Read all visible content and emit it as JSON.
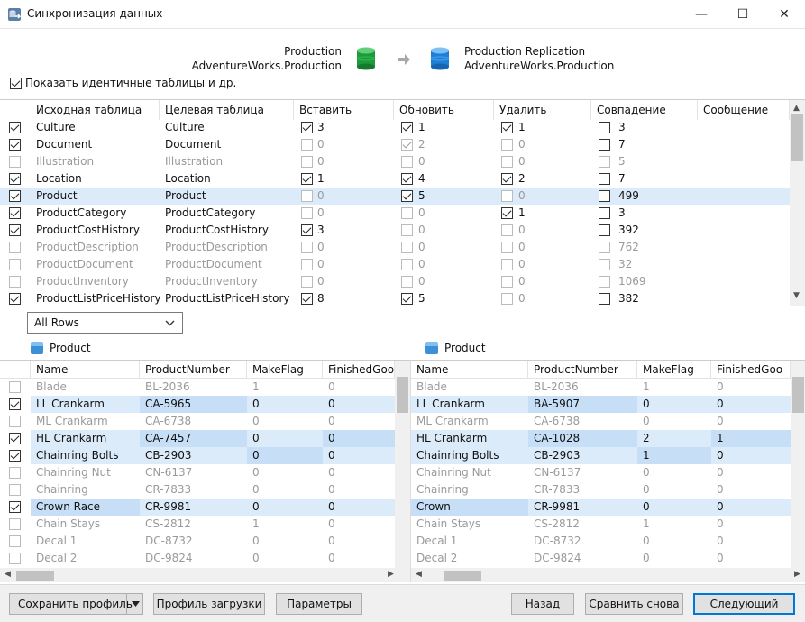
{
  "window": {
    "title": "Синхронизация данных",
    "min": "—",
    "max": "☐",
    "close": "✕"
  },
  "source": {
    "server": "Production",
    "database": "AdventureWorks.Production",
    "color": "#1e9a3c"
  },
  "target": {
    "server": "Production Replication",
    "database": "AdventureWorks.Production",
    "color": "#1e7fd6"
  },
  "show_identical_label": "Показать идентичные таблицы и др.",
  "tables_grid": {
    "headers": [
      "Исходная таблица",
      "Целевая таблица",
      "Вставить",
      "Обновить",
      "Удалить",
      "Совпадение",
      "Сообщение"
    ],
    "rows": [
      {
        "checked": true,
        "enabled": true,
        "src": "Culture",
        "dst": "Culture",
        "ins": "3",
        "ins_on": true,
        "ins_en": true,
        "upd": "1",
        "upd_on": true,
        "upd_en": true,
        "del": "1",
        "del_on": true,
        "del_en": true,
        "match": "3",
        "match_en": true,
        "sel": false
      },
      {
        "checked": true,
        "enabled": true,
        "src": "Document",
        "dst": "Document",
        "ins": "0",
        "ins_on": false,
        "ins_en": false,
        "upd": "2",
        "upd_on": true,
        "upd_en": false,
        "del": "0",
        "del_on": false,
        "del_en": false,
        "match": "7",
        "match_en": true,
        "sel": false
      },
      {
        "checked": false,
        "enabled": false,
        "src": "Illustration",
        "dst": "Illustration",
        "ins": "0",
        "ins_on": false,
        "ins_en": false,
        "upd": "0",
        "upd_on": false,
        "upd_en": false,
        "del": "0",
        "del_on": false,
        "del_en": false,
        "match": "5",
        "match_en": false,
        "sel": false
      },
      {
        "checked": true,
        "enabled": true,
        "src": "Location",
        "dst": "Location",
        "ins": "1",
        "ins_on": true,
        "ins_en": true,
        "upd": "4",
        "upd_on": true,
        "upd_en": true,
        "del": "2",
        "del_on": true,
        "del_en": true,
        "match": "7",
        "match_en": true,
        "sel": false
      },
      {
        "checked": true,
        "enabled": true,
        "src": "Product",
        "dst": "Product",
        "ins": "0",
        "ins_on": false,
        "ins_en": false,
        "upd": "5",
        "upd_on": true,
        "upd_en": true,
        "del": "0",
        "del_on": false,
        "del_en": false,
        "match": "499",
        "match_en": true,
        "sel": true
      },
      {
        "checked": true,
        "enabled": true,
        "src": "ProductCategory",
        "dst": "ProductCategory",
        "ins": "0",
        "ins_on": false,
        "ins_en": false,
        "upd": "0",
        "upd_on": false,
        "upd_en": false,
        "del": "1",
        "del_on": true,
        "del_en": true,
        "match": "3",
        "match_en": true,
        "sel": false
      },
      {
        "checked": true,
        "enabled": true,
        "src": "ProductCostHistory",
        "dst": "ProductCostHistory",
        "ins": "3",
        "ins_on": true,
        "ins_en": true,
        "upd": "0",
        "upd_on": false,
        "upd_en": false,
        "del": "0",
        "del_on": false,
        "del_en": false,
        "match": "392",
        "match_en": true,
        "sel": false
      },
      {
        "checked": false,
        "enabled": false,
        "src": "ProductDescription",
        "dst": "ProductDescription",
        "ins": "0",
        "ins_on": false,
        "ins_en": false,
        "upd": "0",
        "upd_on": false,
        "upd_en": false,
        "del": "0",
        "del_on": false,
        "del_en": false,
        "match": "762",
        "match_en": false,
        "sel": false
      },
      {
        "checked": false,
        "enabled": false,
        "src": "ProductDocument",
        "dst": "ProductDocument",
        "ins": "0",
        "ins_on": false,
        "ins_en": false,
        "upd": "0",
        "upd_on": false,
        "upd_en": false,
        "del": "0",
        "del_on": false,
        "del_en": false,
        "match": "32",
        "match_en": false,
        "sel": false
      },
      {
        "checked": false,
        "enabled": false,
        "src": "ProductInventory",
        "dst": "ProductInventory",
        "ins": "0",
        "ins_on": false,
        "ins_en": false,
        "upd": "0",
        "upd_on": false,
        "upd_en": false,
        "del": "0",
        "del_on": false,
        "del_en": false,
        "match": "1069",
        "match_en": false,
        "sel": false
      },
      {
        "checked": true,
        "enabled": true,
        "src": "ProductListPriceHistory",
        "dst": "ProductListPriceHistory",
        "ins": "8",
        "ins_on": true,
        "ins_en": true,
        "upd": "5",
        "upd_on": true,
        "upd_en": true,
        "del": "0",
        "del_on": false,
        "del_en": false,
        "match": "382",
        "match_en": true,
        "sel": false
      }
    ]
  },
  "filter": {
    "value": "All Rows"
  },
  "left_panel": {
    "title": "Product",
    "headers": [
      "Name",
      "ProductNumber",
      "MakeFlag",
      "FinishedGoo"
    ],
    "rows": [
      {
        "check": false,
        "state": "same",
        "name": "Blade",
        "num": "BL-2036",
        "make": "1",
        "fin": "0",
        "diff": []
      },
      {
        "check": true,
        "state": "diff",
        "name": "LL Crankarm",
        "num": "CA-5965",
        "make": "0",
        "fin": "0",
        "diff": [
          1
        ]
      },
      {
        "check": false,
        "state": "same",
        "name": "ML Crankarm",
        "num": "CA-6738",
        "make": "0",
        "fin": "0",
        "diff": []
      },
      {
        "check": true,
        "state": "diff",
        "name": "HL Crankarm",
        "num": "CA-7457",
        "make": "0",
        "fin": "0",
        "diff": [
          1,
          3
        ]
      },
      {
        "check": true,
        "state": "diff",
        "name": "Chainring Bolts",
        "num": "CB-2903",
        "make": "0",
        "fin": "0",
        "diff": [
          2
        ]
      },
      {
        "check": false,
        "state": "same",
        "name": "Chainring Nut",
        "num": "CN-6137",
        "make": "0",
        "fin": "0",
        "diff": []
      },
      {
        "check": false,
        "state": "same",
        "name": "Chainring",
        "num": "CR-7833",
        "make": "0",
        "fin": "0",
        "diff": []
      },
      {
        "check": true,
        "state": "diff",
        "name": "Crown Race",
        "num": "CR-9981",
        "make": "0",
        "fin": "0",
        "diff": [
          0
        ]
      },
      {
        "check": false,
        "state": "same",
        "name": "Chain Stays",
        "num": "CS-2812",
        "make": "1",
        "fin": "0",
        "diff": []
      },
      {
        "check": false,
        "state": "same",
        "name": "Decal 1",
        "num": "DC-8732",
        "make": "0",
        "fin": "0",
        "diff": []
      },
      {
        "check": false,
        "state": "same",
        "name": "Decal 2",
        "num": "DC-9824",
        "make": "0",
        "fin": "0",
        "diff": []
      }
    ]
  },
  "right_panel": {
    "title": "Product",
    "headers": [
      "Name",
      "ProductNumber",
      "MakeFlag",
      "FinishedGoo"
    ],
    "rows": [
      {
        "state": "same",
        "name": "Blade",
        "num": "BL-2036",
        "make": "1",
        "fin": "0",
        "diff": []
      },
      {
        "state": "diff",
        "name": "LL Crankarm",
        "num": "BA-5907",
        "make": "0",
        "fin": "0",
        "diff": [
          1
        ]
      },
      {
        "state": "same",
        "name": "ML Crankarm",
        "num": "CA-6738",
        "make": "0",
        "fin": "0",
        "diff": []
      },
      {
        "state": "diff",
        "name": "HL Crankarm",
        "num": "CA-1028",
        "make": "2",
        "fin": "1",
        "diff": [
          1,
          3
        ]
      },
      {
        "state": "diff",
        "name": "Chainring Bolts",
        "num": "CB-2903",
        "make": "1",
        "fin": "0",
        "diff": [
          2
        ]
      },
      {
        "state": "same",
        "name": "Chainring Nut",
        "num": "CN-6137",
        "make": "0",
        "fin": "0",
        "diff": []
      },
      {
        "state": "same",
        "name": "Chainring",
        "num": "CR-7833",
        "make": "0",
        "fin": "0",
        "diff": []
      },
      {
        "state": "diff",
        "name": "Crown",
        "num": "CR-9981",
        "make": "0",
        "fin": "0",
        "diff": [
          0
        ]
      },
      {
        "state": "same",
        "name": "Chain Stays",
        "num": "CS-2812",
        "make": "1",
        "fin": "0",
        "diff": []
      },
      {
        "state": "same",
        "name": "Decal 1",
        "num": "DC-8732",
        "make": "0",
        "fin": "0",
        "diff": []
      },
      {
        "state": "same",
        "name": "Decal 2",
        "num": "DC-9824",
        "make": "0",
        "fin": "0",
        "diff": []
      }
    ]
  },
  "buttons": {
    "save_profile": "Сохранить профиль",
    "load_profile": "Профиль загрузки",
    "params": "Параметры",
    "back": "Назад",
    "compare_again": "Сравнить снова",
    "next": "Следующий"
  }
}
